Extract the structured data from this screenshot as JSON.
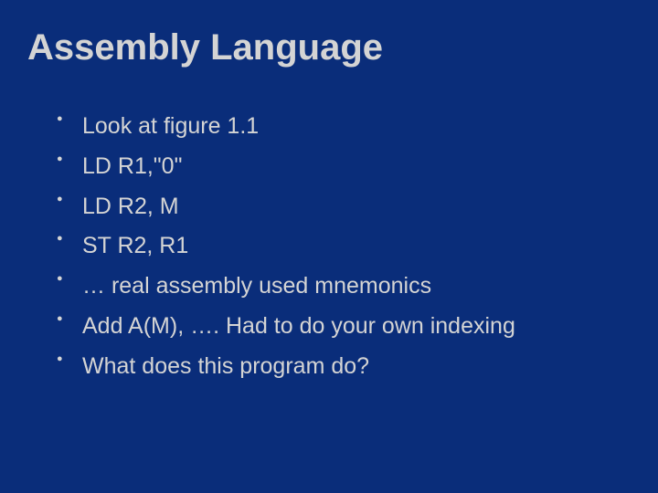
{
  "slide": {
    "title": "Assembly Language",
    "bullets": [
      "Look at figure 1.1",
      "LD   R1,\"0\"",
      "LD    R2, M",
      "ST    R2, R1",
      "…  real assembly used mnemonics",
      "Add  A(M), …. Had to do your own indexing",
      "What does this program do?"
    ]
  }
}
